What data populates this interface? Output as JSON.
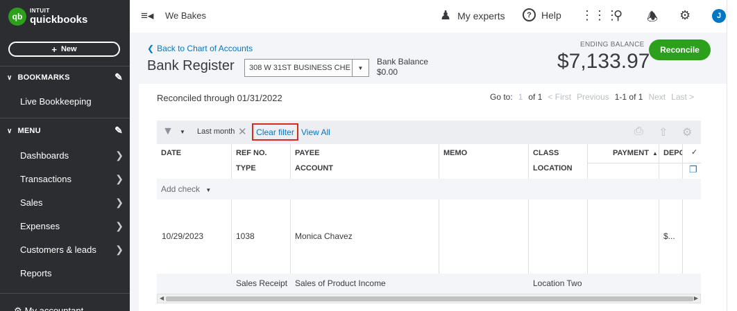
{
  "sidebar": {
    "logo_intuit": "INTUIT",
    "logo_quickbooks": "quickbooks",
    "logo_mark": "qb",
    "new_label": "New",
    "bookmarks_label": "BOOKMARKS",
    "bookmark_items": [
      "Live Bookkeeping"
    ],
    "menu_label": "MENU",
    "menu_items": [
      "Dashboards",
      "Transactions",
      "Sales",
      "Expenses",
      "Customers & leads",
      "Reports"
    ],
    "partial_item": "My accountant"
  },
  "topbar": {
    "company": "We Bakes",
    "my_experts": "My experts",
    "help": "Help",
    "avatar_initial": "J"
  },
  "header": {
    "back_link": "Back to Chart of Accounts",
    "title": "Bank Register",
    "account_select": "308 W 31ST BUSINESS CHE",
    "bank_balance_label": "Bank Balance",
    "bank_balance_value": "$0.00",
    "ending_balance_label": "ENDING BALANCE",
    "ending_balance_value": "$7,133.97",
    "reconcile_label": "Reconcile"
  },
  "register": {
    "reconciled_through": "Reconciled through 01/31/2022",
    "pager": {
      "goto_label": "Go to:",
      "page_input": "1",
      "of_pages": "of 1",
      "first": "< First",
      "previous": "Previous",
      "range": "1-1 of 1",
      "next": "Next",
      "last": "Last >"
    },
    "filter": {
      "chip_label": "Last month",
      "clear_filter": "Clear filter",
      "view_all": "View All"
    },
    "columns": {
      "date": "DATE",
      "ref_no": "REF NO.",
      "type": "TYPE",
      "payee": "PAYEE",
      "account": "ACCOUNT",
      "memo": "MEMO",
      "class": "CLASS",
      "location": "LOCATION",
      "payment": "PAYMENT",
      "deposit": "DEPO",
      "check": "✓"
    },
    "add_check": "Add check",
    "rows": [
      {
        "date": "10/29/2023",
        "ref_no": "1038",
        "payee": "Monica Chavez",
        "deposit": "$...",
        "type": "Sales Receipt",
        "account": "Sales of Product Income",
        "location": "Location Two"
      }
    ]
  },
  "colors": {
    "brand_green": "#2ca01c",
    "link_blue": "#0077c5",
    "sidebar_bg": "#2b2d31",
    "highlight_red": "#d52b1e"
  }
}
